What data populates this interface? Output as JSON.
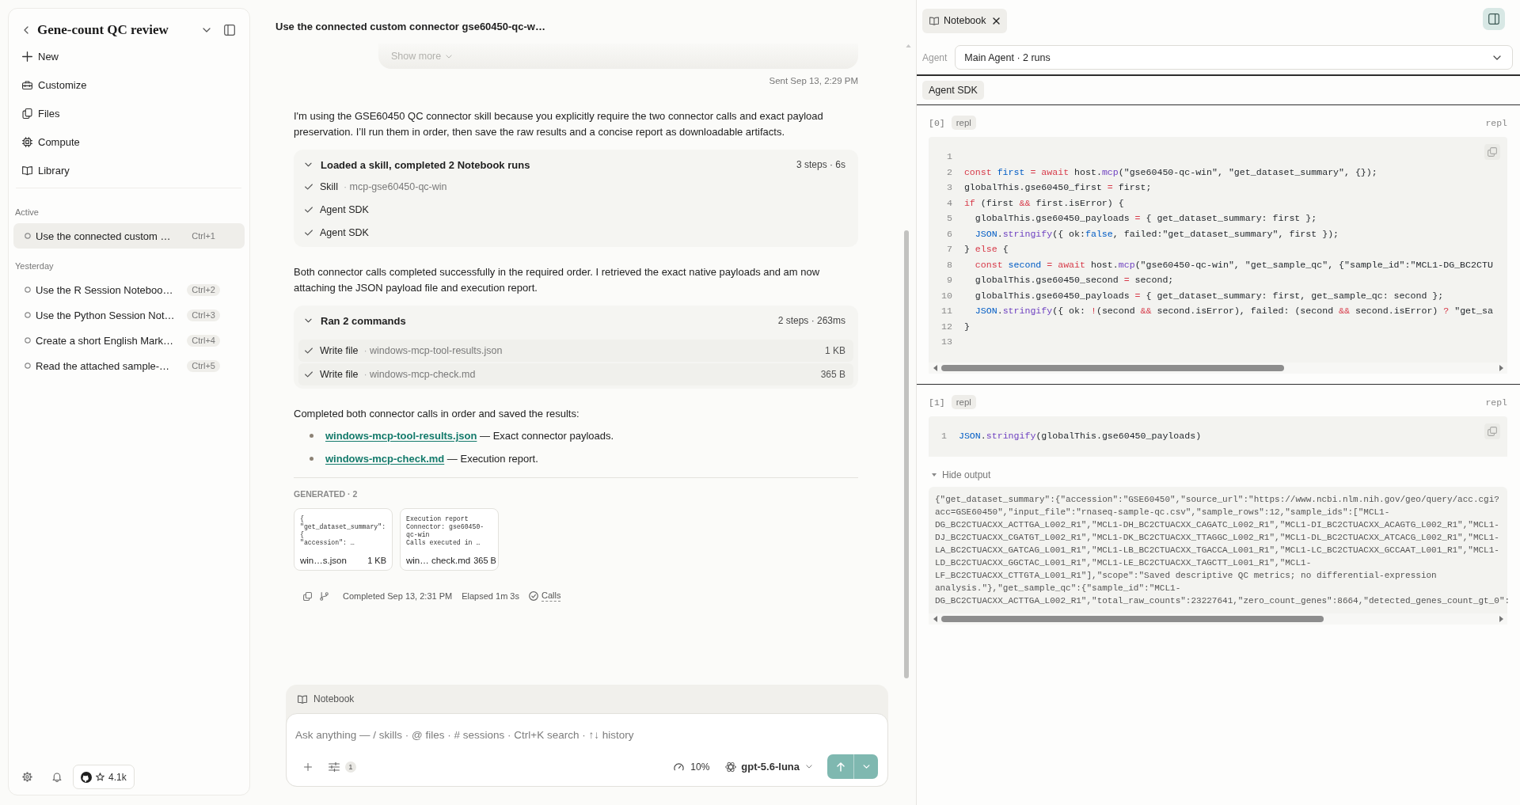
{
  "sidebar": {
    "title": "Gene-count QC review",
    "nav": [
      "New",
      "Customize",
      "Files",
      "Compute",
      "Library"
    ],
    "groups": [
      {
        "label": "Active",
        "items": [
          {
            "title": "Use the connected custom …",
            "shortcut": "Ctrl+1",
            "selected": true
          }
        ]
      },
      {
        "label": "Yesterday",
        "items": [
          {
            "title": "Use the R Session Noteboo…",
            "shortcut": "Ctrl+2",
            "selected": false
          },
          {
            "title": "Use the Python Session Not…",
            "shortcut": "Ctrl+3",
            "selected": false
          },
          {
            "title": "Create a short English Mark…",
            "shortcut": "Ctrl+4",
            "selected": false
          },
          {
            "title": "Read the attached sample-…",
            "shortcut": "Ctrl+5",
            "selected": false
          }
        ]
      }
    ],
    "star_count": "4.1k"
  },
  "thread": {
    "title": "Use the connected custom connector gse60450-qc-w…",
    "user_message": {
      "show_more": "Show more",
      "sent": "Sent Sep 13, 2:29 PM"
    },
    "response": [
      {
        "kind": "paragraph",
        "text": "I'm using the GSE60450 QC connector skill because you explicitly require the two connector calls and exact payload preservation. I’ll run them in order, then save the raw results and a concise report as downloadable artifacts."
      },
      {
        "kind": "steps",
        "title": "Loaded a skill, completed 2 Notebook runs",
        "summary": "3 steps · 6s",
        "expanded": true,
        "steps": [
          {
            "label": "Skill",
            "sep": "·",
            "detail": "mcp-gse60450-qc-win"
          },
          {
            "label": "Agent SDK"
          },
          {
            "label": "Agent SDK"
          }
        ]
      },
      {
        "kind": "paragraph",
        "text": "Both connector calls completed successfully in the required order. I retrieved the exact native payloads and am now attaching the JSON payload file and execution report."
      },
      {
        "kind": "steps",
        "title": "Ran 2 commands",
        "summary": "2 steps · 263ms",
        "expanded": true,
        "steps": [
          {
            "label": "Write file",
            "sep": "·",
            "detail": "windows-mcp-tool-results.json",
            "size": "1 KB"
          },
          {
            "label": "Write file",
            "sep": "·",
            "detail": "windows-mcp-check.md",
            "size": "365 B"
          }
        ]
      },
      {
        "kind": "paragraph",
        "text": "Completed both connector calls in order and saved the results:"
      },
      {
        "kind": "bullets",
        "items": [
          {
            "link": "windows-mcp-tool-results.json",
            "text": "— Exact connector payloads."
          },
          {
            "link": "windows-mcp-check.md",
            "text": "— Execution report."
          }
        ]
      }
    ],
    "generated": {
      "label": "GENERATED · 2",
      "files": [
        {
          "preview": [
            "{",
            "\"get_dataset_summary\":",
            "{",
            "\"accession\": …"
          ],
          "name": "win…s.json",
          "size": "1 KB"
        },
        {
          "preview": [
            "Execution report",
            "Connector: gse60450-",
            "qc-win",
            "Calls executed in …"
          ],
          "name": "win… check.md",
          "size": "365 B"
        }
      ]
    },
    "footer": {
      "completed": "Completed Sep 13, 2:31 PM",
      "elapsed": "Elapsed 1m 3s",
      "calls": "Calls"
    }
  },
  "composer": {
    "context": "Notebook",
    "placeholder": "Ask anything — / skills · @ files · # sessions · Ctrl+K search · ↑↓ history",
    "tool_count": "1",
    "context_usage": "10%",
    "model": "gpt-5.6-luna"
  },
  "notebook": {
    "tabs": [
      {
        "label": "Notebook",
        "selected": true
      }
    ],
    "agent_label": "Agent",
    "agent_value": "Main Agent · 2 runs",
    "filter_chip": "Agent SDK",
    "cells": [
      {
        "index": "[0]",
        "tag": "repl",
        "language": "repl",
        "lines": [
          {
            "n": "1"
          },
          {
            "n": "2",
            "tokens": [
              {
                "kind": "kw",
                "text": "const "
              },
              {
                "kind": "var",
                "text": "first"
              },
              {
                "kind": "kw",
                "text": " = await"
              },
              {
                "kind": "txt",
                "text": " host."
              },
              {
                "kind": "fn",
                "text": "mcp"
              },
              {
                "kind": "txt",
                "text": "(\"gse60450-qc-win\", \"get_dataset_summary\", {});"
              }
            ]
          },
          {
            "n": "3",
            "tokens": [
              {
                "kind": "txt",
                "text": "globalThis.gse60450_first "
              },
              {
                "kind": "kw",
                "text": "="
              },
              {
                "kind": "txt",
                "text": " first;"
              }
            ]
          },
          {
            "n": "4",
            "tokens": [
              {
                "kind": "kw",
                "text": "if"
              },
              {
                "kind": "txt",
                "text": " (first "
              },
              {
                "kind": "kw",
                "text": "&&"
              },
              {
                "kind": "txt",
                "text": " first.isError) {"
              }
            ]
          },
          {
            "n": "5",
            "tokens": [
              {
                "kind": "txt",
                "text": "  globalThis.gse60450_payloads "
              },
              {
                "kind": "kw",
                "text": "="
              },
              {
                "kind": "txt",
                "text": " { get_dataset_summary: first };"
              }
            ]
          },
          {
            "n": "6",
            "tokens": [
              {
                "kind": "var",
                "text": "  JSON"
              },
              {
                "kind": "txt",
                "text": "."
              },
              {
                "kind": "fn",
                "text": "stringify"
              },
              {
                "kind": "txt",
                "text": "({ ok:"
              },
              {
                "kind": "var",
                "text": "false"
              },
              {
                "kind": "txt",
                "text": ", failed:\"get_dataset_summary\", first });"
              }
            ]
          },
          {
            "n": "7",
            "tokens": [
              {
                "kind": "txt",
                "text": "} "
              },
              {
                "kind": "kw",
                "text": "else"
              },
              {
                "kind": "txt",
                "text": " {"
              }
            ]
          },
          {
            "n": "8",
            "tokens": [
              {
                "kind": "kw",
                "text": "  const "
              },
              {
                "kind": "var",
                "text": "second"
              },
              {
                "kind": "kw",
                "text": " = await"
              },
              {
                "kind": "txt",
                "text": " host."
              },
              {
                "kind": "fn",
                "text": "mcp"
              },
              {
                "kind": "txt",
                "text": "(\"gse60450-qc-win\", \"get_sample_qc\", {\"sample_id\":\"MCL1-DG_BC2CTU"
              }
            ]
          },
          {
            "n": "9",
            "tokens": [
              {
                "kind": "txt",
                "text": "  globalThis.gse60450_second "
              },
              {
                "kind": "kw",
                "text": "="
              },
              {
                "kind": "txt",
                "text": " second;"
              }
            ]
          },
          {
            "n": "10",
            "tokens": [
              {
                "kind": "txt",
                "text": "  globalThis.gse60450_payloads "
              },
              {
                "kind": "kw",
                "text": "="
              },
              {
                "kind": "txt",
                "text": " { get_dataset_summary: first, get_sample_qc: second };"
              }
            ]
          },
          {
            "n": "11",
            "tokens": [
              {
                "kind": "var",
                "text": "  JSON"
              },
              {
                "kind": "txt",
                "text": "."
              },
              {
                "kind": "fn",
                "text": "stringify"
              },
              {
                "kind": "txt",
                "text": "({ ok: "
              },
              {
                "kind": "kw",
                "text": "!"
              },
              {
                "kind": "txt",
                "text": "(second "
              },
              {
                "kind": "kw",
                "text": "&&"
              },
              {
                "kind": "txt",
                "text": " second.isError), failed: (second "
              },
              {
                "kind": "kw",
                "text": "&&"
              },
              {
                "kind": "txt",
                "text": " second.isError) "
              },
              {
                "kind": "kw",
                "text": "?"
              },
              {
                "kind": "txt",
                "text": " \"get_sa"
              }
            ]
          },
          {
            "n": "12",
            "tokens": [
              {
                "kind": "txt",
                "text": "}"
              }
            ]
          },
          {
            "n": "13"
          }
        ]
      },
      {
        "index": "[1]",
        "tag": "repl",
        "language": "repl",
        "lines": [
          {
            "n": "1",
            "tokens": [
              {
                "kind": "var",
                "text": "JSON"
              },
              {
                "kind": "txt",
                "text": "."
              },
              {
                "kind": "fn",
                "text": "stringify"
              },
              {
                "kind": "txt",
                "text": "(globalThis.gse60450_payloads)"
              }
            ]
          }
        ],
        "output": {
          "toggle": "Hide output",
          "expanded": true,
          "lines": [
            "{\"get_dataset_summary\":{\"accession\":\"GSE60450\",\"source_url\":\"https://www.ncbi.nlm.nih.gov/geo/query/acc.cgi?",
            "acc=GSE60450\",\"input_file\":\"rnaseq-sample-qc.csv\",\"sample_rows\":12,\"sample_ids\":[\"MCL1-",
            "DG_BC2CTUACXX_ACTTGA_L002_R1\",\"MCL1-DH_BC2CTUACXX_CAGATC_L002_R1\",\"MCL1-DI_BC2CTUACXX_ACAGTG_L002_R1\",\"MCL1-",
            "DJ_BC2CTUACXX_CGATGT_L002_R1\",\"MCL1-DK_BC2CTUACXX_TTAGGC_L002_R1\",\"MCL1-DL_BC2CTUACXX_ATCACG_L002_R1\",\"MCL1-",
            "LA_BC2CTUACXX_GATCAG_L001_R1\",\"MCL1-LB_BC2CTUACXX_TGACCA_L001_R1\",\"MCL1-LC_BC2CTUACXX_GCCAAT_L001_R1\",\"MCL1-",
            "LD_BC2CTUACXX_GGCTAC_L001_R1\",\"MCL1-LE_BC2CTUACXX_TAGCTT_L001_R1\",\"MCL1-",
            "LF_BC2CTUACXX_CTTGTA_L001_R1\"],\"scope\":\"Saved descriptive QC metrics; no differential-expression",
            "analysis.\"},\"get_sample_qc\":{\"sample_id\":\"MCL1-",
            "DG_BC2CTUACXX_ACTTGA_L002_R1\",\"total_raw_counts\":23227641,\"zero_count_genes\":8664,\"detected_genes_count_gt_0\":"
          ]
        }
      }
    ]
  }
}
